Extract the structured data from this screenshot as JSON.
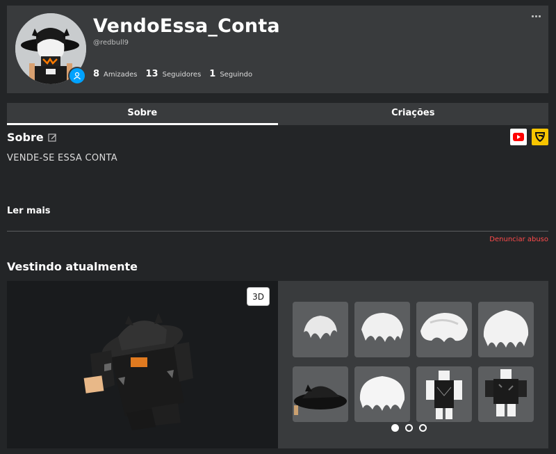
{
  "profile": {
    "display_name": "VendoEssa_Conta",
    "username": "@redbull9",
    "stats": [
      {
        "value": "8",
        "label": "Amizades"
      },
      {
        "value": "13",
        "label": "Seguidores"
      },
      {
        "value": "1",
        "label": "Seguindo"
      }
    ],
    "presence_icon": "online-person-icon"
  },
  "tabs": [
    {
      "label": "Sobre",
      "active": true
    },
    {
      "label": "Criações",
      "active": false
    }
  ],
  "about": {
    "title": "Sobre",
    "text": "VENDE-SE ESSA CONTA",
    "read_more": "Ler mais",
    "report": "Denunciar abuso",
    "social": [
      "youtube-icon",
      "guilded-icon"
    ]
  },
  "wearing": {
    "title": "Vestindo atualmente",
    "toggle_3d": "3D",
    "items": [
      "hair-item",
      "hair-item",
      "hair-item",
      "hair-item",
      "hat-item",
      "hair-item",
      "shirt-item",
      "shirt-item"
    ],
    "page": 1,
    "page_count": 3
  },
  "colors": {
    "background": "#232527",
    "card": "#393b3d",
    "item_tile": "#5c5e60",
    "accent_blue": "#00a2ff",
    "report_red": "#ff4b4b",
    "guilded_yellow": "#f7c500"
  }
}
